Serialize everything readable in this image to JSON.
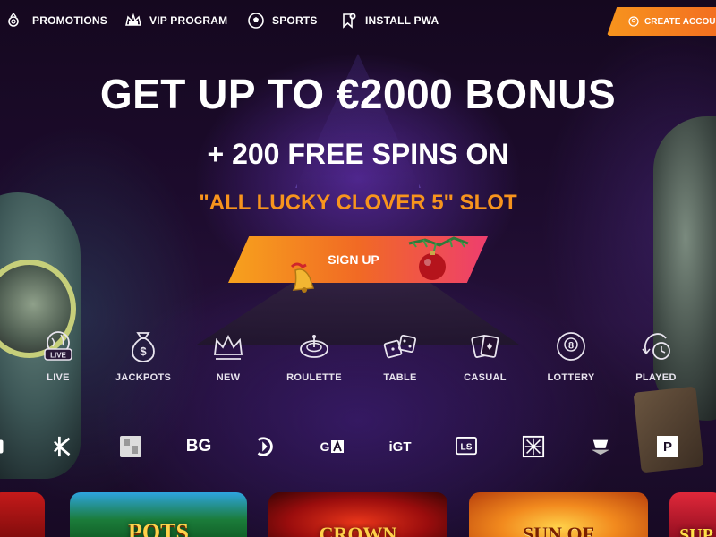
{
  "nav": {
    "promotions": "PROMOTIONS",
    "vip": "VIP PROGRAM",
    "sports": "SPORTS",
    "install": "INSTALL PWA",
    "create_account": "CREATE ACCOUN"
  },
  "hero": {
    "title": "GET UP TO €2000 BONUS",
    "subtitle": "+ 200 FREE SPINS ON",
    "slot": "\"ALL LUCKY CLOVER 5\" SLOT",
    "signup": "SIGN UP"
  },
  "categories": [
    {
      "label": "LIVE",
      "icon": "live-globe-icon"
    },
    {
      "label": "JACKPOTS",
      "icon": "money-bag-icon"
    },
    {
      "label": "NEW",
      "icon": "crown-icon"
    },
    {
      "label": "ROULETTE",
      "icon": "roulette-icon"
    },
    {
      "label": "TABLE",
      "icon": "dice-icon"
    },
    {
      "label": "CASUAL",
      "icon": "cards-icon"
    },
    {
      "label": "LOTTERY",
      "icon": "eight-ball-icon"
    },
    {
      "label": "PLAYED",
      "icon": "history-clock-icon"
    }
  ],
  "providers": {
    "bg": "BG",
    "ga": "G",
    "igt": "iGT",
    "ls": "LS",
    "p": "P"
  },
  "tiles": {
    "pots": "POTS",
    "crown": "CROWN",
    "sun": "SUN OF",
    "sup": "SUP"
  },
  "colors": {
    "accent_orange": "#f7941d",
    "accent_pink": "#ee3e6e"
  }
}
